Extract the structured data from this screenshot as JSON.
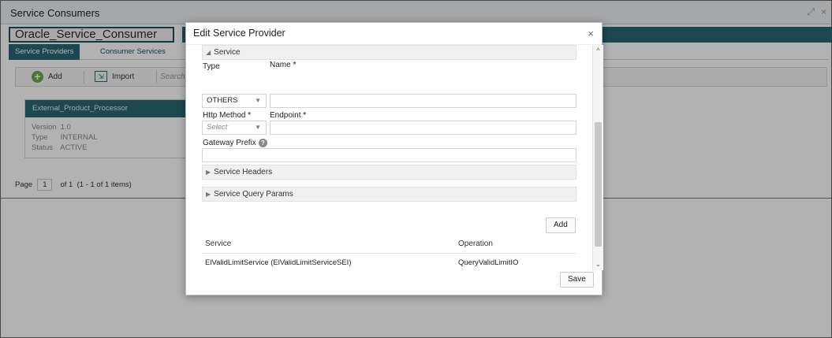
{
  "app": {
    "title": "Service Consumers",
    "consumer_name": "Oracle_Service_Consumer",
    "tabs": [
      "Service Providers",
      "Consumer Services"
    ],
    "toolbar": {
      "add_label": "Add",
      "import_label": "Import",
      "search_placeholder": "Search"
    },
    "card": {
      "name": "External_Product_Processor",
      "version_label": "Version",
      "version_value": "1.0",
      "type_label": "Type",
      "type_value": "INTERNAL",
      "status_label": "Status",
      "status_value": "ACTIVE"
    },
    "pager": {
      "page_label": "Page",
      "page_value": "1",
      "of_label": "of 1",
      "items_label": "(1 - 1 of 1 items)"
    }
  },
  "modal": {
    "title": "Edit Service Provider",
    "close_glyph": "×",
    "section_title": "Service",
    "type_label": "Type",
    "type_value": "OTHERS",
    "name_label": "Name",
    "name_value": "",
    "http_method_label": "Http Method",
    "http_method_placeholder": "Select",
    "endpoint_label": "Endpoint",
    "endpoint_value": "",
    "gateway_prefix_label": "Gateway Prefix",
    "gateway_prefix_value": "",
    "service_headers_label": "Service Headers",
    "service_query_params_label": "Service Query Params",
    "add_label": "Add",
    "table": {
      "columns": [
        "Service",
        "Operation"
      ],
      "rows": [
        {
          "service": "ElValidLimitService (ElValidLimitServiceSEI)",
          "operation": "QueryValidLimitIO"
        }
      ]
    },
    "save_label": "Save"
  },
  "required_marker": "*",
  "help_glyph": "?"
}
